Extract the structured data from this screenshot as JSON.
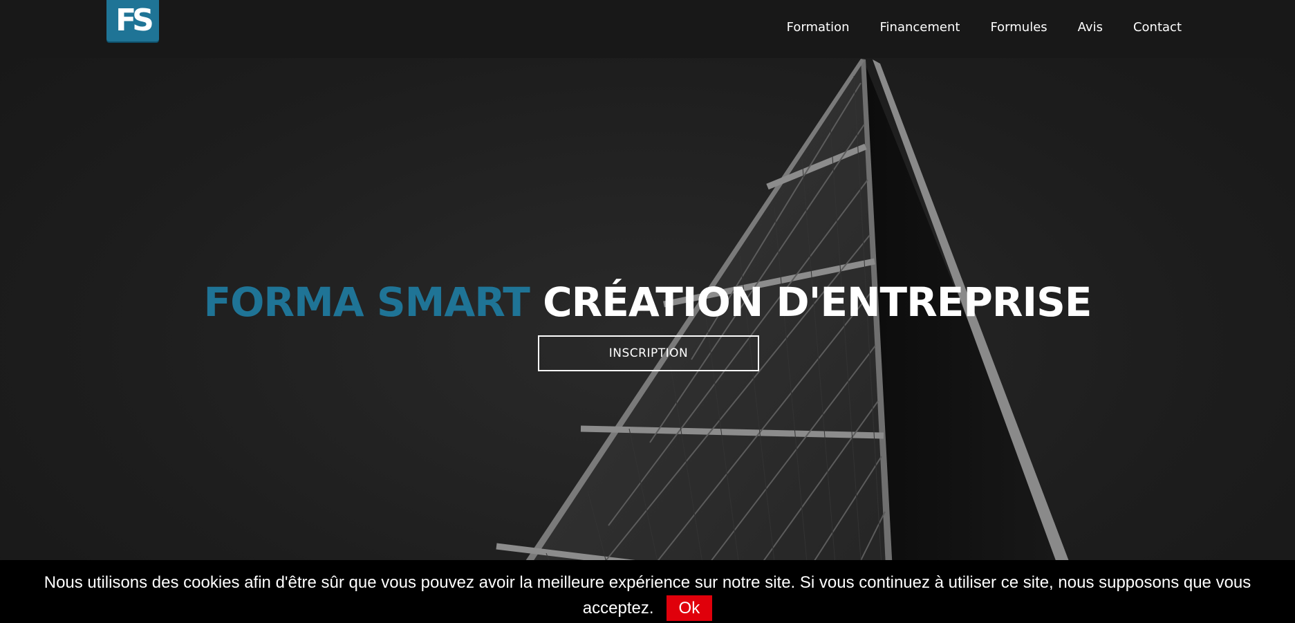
{
  "header": {
    "logo": {
      "text": "FS"
    },
    "nav": [
      "Formation",
      "Financement",
      "Formules",
      "Avis",
      "Contact"
    ]
  },
  "hero": {
    "title_brand": "FORMA SMART",
    "title_rest": "CRÉATION D'ENTREPRISE",
    "cta": "INSCRIPTION",
    "background_image": "glass-skyscraper-photo"
  },
  "cookie_banner": {
    "text_line1": "Nous utilisons des cookies afin d'être sûr que vous pouvez avoir la meilleure expérience sur notre site. Si vous continuez à utiliser ce site, nous supposons que vous",
    "text_line2": "acceptez.",
    "button": "Ok"
  },
  "colors": {
    "brand": "#1f7496",
    "nav_bg": "#181818",
    "cookie_bg": "#000000",
    "ok_button": "#e0000b"
  }
}
